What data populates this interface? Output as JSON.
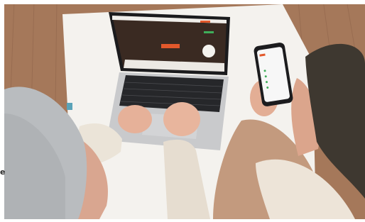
{
  "photo": {
    "subject": "two-people-using-laptop-and-phone",
    "edge_glyph": "e",
    "colors": {
      "floor": "#a5785a",
      "table": "#f4f2ee",
      "laptop": "#c9cacc",
      "screen_content": "#3a2a22",
      "brand_accent": "#e2582b",
      "left_sweater": "#ebe4d8",
      "right_coat": "#c39a7e",
      "beanie_left": "#b9bcbf",
      "beanie_right": "#3e3830"
    },
    "icons": [
      "laptop-icon",
      "phone-icon"
    ]
  }
}
